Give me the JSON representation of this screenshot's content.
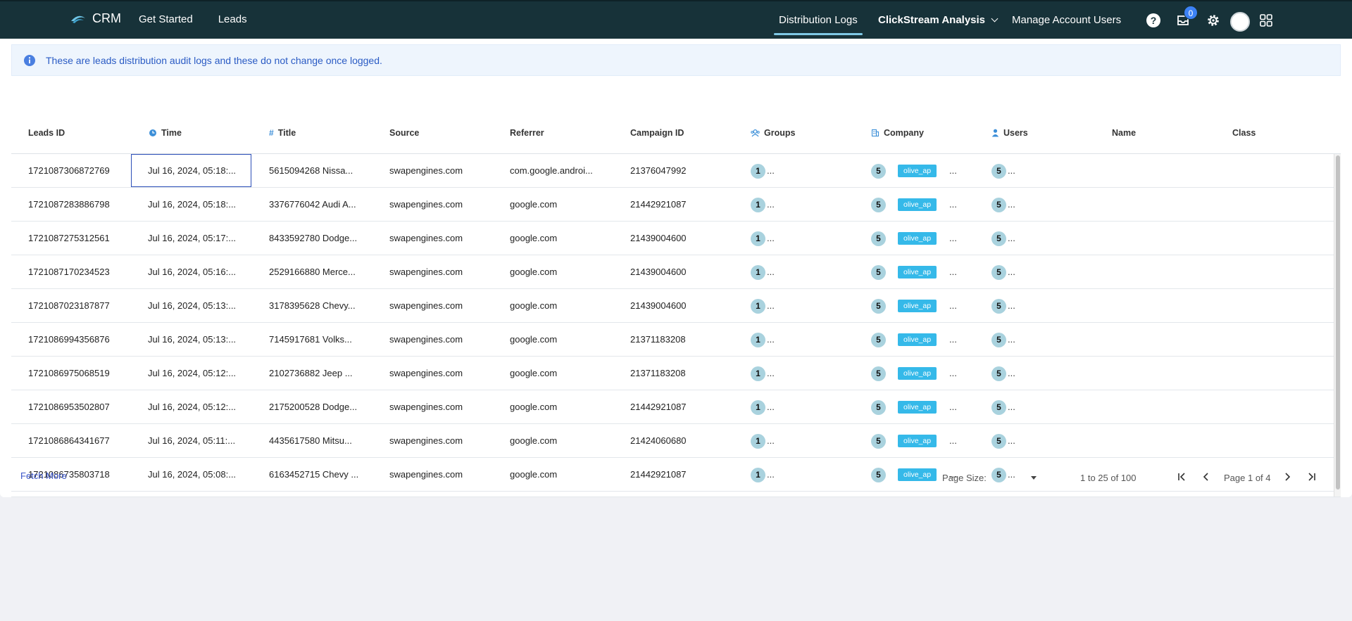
{
  "header": {
    "brand": "CRM",
    "nav_left": [
      "Get Started",
      "Leads"
    ],
    "tabs": {
      "distribution_logs": "Distribution Logs",
      "clickstream": "ClickStream Analysis",
      "manage_users": "Manage Account Users"
    },
    "inbox_count": "0",
    "icons": [
      "help-icon",
      "inbox-icon",
      "gear-icon",
      "avatar",
      "apps-grid-icon"
    ]
  },
  "banner": {
    "text": "These are leads distribution audit logs and these do not change once logged."
  },
  "columns": {
    "leads_id": "Leads ID",
    "time": "Time",
    "title": "Title",
    "source": "Source",
    "referrer": "Referrer",
    "campaign_id": "Campaign ID",
    "groups": "Groups",
    "company": "Company",
    "users": "Users",
    "name": "Name",
    "class": "Class"
  },
  "rows": [
    {
      "id": "1721087306872769",
      "time": "Jul 16, 2024, 05:18:...",
      "title": "5615094268 Nissa...",
      "source": "swapengines.com",
      "referrer": "com.google.androi...",
      "campaign": "21376047992",
      "groups": "1",
      "company": "5",
      "company_tag": "olive_ap",
      "users": "5"
    },
    {
      "id": "1721087283886798",
      "time": "Jul 16, 2024, 05:18:...",
      "title": "3376776042 Audi A...",
      "source": "swapengines.com",
      "referrer": "google.com",
      "campaign": "21442921087",
      "groups": "1",
      "company": "5",
      "company_tag": "olive_ap",
      "users": "5"
    },
    {
      "id": "1721087275312561",
      "time": "Jul 16, 2024, 05:17:...",
      "title": "8433592780 Dodge...",
      "source": "swapengines.com",
      "referrer": "google.com",
      "campaign": "21439004600",
      "groups": "1",
      "company": "5",
      "company_tag": "olive_ap",
      "users": "5"
    },
    {
      "id": "1721087170234523",
      "time": "Jul 16, 2024, 05:16:...",
      "title": "2529166880 Merce...",
      "source": "swapengines.com",
      "referrer": "google.com",
      "campaign": "21439004600",
      "groups": "1",
      "company": "5",
      "company_tag": "olive_ap",
      "users": "5"
    },
    {
      "id": "1721087023187877",
      "time": "Jul 16, 2024, 05:13:...",
      "title": "3178395628 Chevy...",
      "source": "swapengines.com",
      "referrer": "google.com",
      "campaign": "21439004600",
      "groups": "1",
      "company": "5",
      "company_tag": "olive_ap",
      "users": "5"
    },
    {
      "id": "1721086994356876",
      "time": "Jul 16, 2024, 05:13:...",
      "title": "7145917681 Volks...",
      "source": "swapengines.com",
      "referrer": "google.com",
      "campaign": "21371183208",
      "groups": "1",
      "company": "5",
      "company_tag": "olive_ap",
      "users": "5"
    },
    {
      "id": "1721086975068519",
      "time": "Jul 16, 2024, 05:12:...",
      "title": "2102736882 Jeep ...",
      "source": "swapengines.com",
      "referrer": "google.com",
      "campaign": "21371183208",
      "groups": "1",
      "company": "5",
      "company_tag": "olive_ap",
      "users": "5"
    },
    {
      "id": "1721086953502807",
      "time": "Jul 16, 2024, 05:12:...",
      "title": "2175200528 Dodge...",
      "source": "swapengines.com",
      "referrer": "google.com",
      "campaign": "21442921087",
      "groups": "1",
      "company": "5",
      "company_tag": "olive_ap",
      "users": "5"
    },
    {
      "id": "1721086864341677",
      "time": "Jul 16, 2024, 05:11:...",
      "title": "4435617580 Mitsu...",
      "source": "swapengines.com",
      "referrer": "google.com",
      "campaign": "21424060680",
      "groups": "1",
      "company": "5",
      "company_tag": "olive_ap",
      "users": "5"
    },
    {
      "id": "1721086735803718",
      "time": "Jul 16, 2024, 05:08:...",
      "title": "6163452715 Chevy ...",
      "source": "swapengines.com",
      "referrer": "google.com",
      "campaign": "21442921087",
      "groups": "1",
      "company": "5",
      "company_tag": "olive_ap",
      "users": "5"
    }
  ],
  "cell_ellipsis": "...",
  "footer": {
    "fetch_more": "Fetch More",
    "page_size_label": "Page Size:",
    "range": "1 to 25 of 100",
    "page": "Page 1 of 4"
  },
  "colors": {
    "topbar": "#173239",
    "accent": "#7fc8e6",
    "badge": "#3c82f6",
    "tag": "#35b9e9",
    "chip": "#a9d2de"
  }
}
